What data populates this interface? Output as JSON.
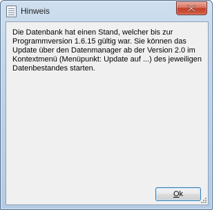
{
  "window": {
    "title": "Hinweis",
    "icon": "notepad-icon",
    "close_icon": "close-icon"
  },
  "message": {
    "text": "Die Datenbank hat einen Stand, welcher bis zur Programmversion 1.6.15 gültig war. Sie können das Update über den Datenmanager ab der Version 2.0 im Kontextmenü (Menüpunkt: Update auf ...) des jeweiligen Datenbestandes starten."
  },
  "buttons": {
    "ok_mnemonic": "O",
    "ok_rest": "k"
  }
}
